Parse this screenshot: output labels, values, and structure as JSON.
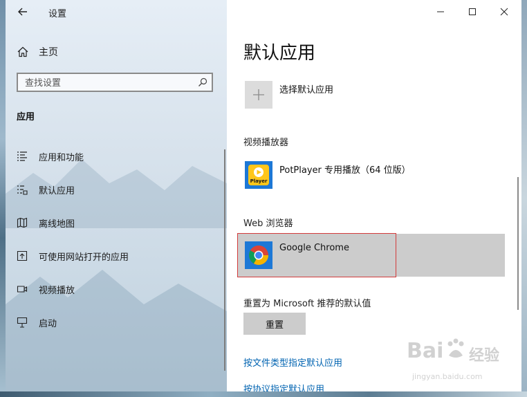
{
  "window": {
    "title": "设置"
  },
  "sidebar": {
    "home_label": "主页",
    "search_placeholder": "查找设置",
    "section_title": "应用",
    "items": [
      {
        "label": "应用和功能",
        "icon": "list-icon"
      },
      {
        "label": "默认应用",
        "icon": "default-apps-icon"
      },
      {
        "label": "离线地图",
        "icon": "map-icon"
      },
      {
        "label": "可使用网站打开的应用",
        "icon": "open-in-icon"
      },
      {
        "label": "视频播放",
        "icon": "video-icon"
      },
      {
        "label": "启动",
        "icon": "startup-icon"
      }
    ]
  },
  "main": {
    "title": "默认应用",
    "choose_default_label": "选择默认应用",
    "video_player": {
      "group": "视频播放器",
      "app": "PotPlayer 专用播放（64 位版）",
      "icon_text": "Player"
    },
    "web_browser": {
      "group": "Web 浏览器",
      "app": "Google Chrome"
    },
    "reset": {
      "label": "重置为 Microsoft 推荐的默认值",
      "button": "重置"
    },
    "links": [
      "按文件类型指定默认应用",
      "按协议指定默认应用"
    ]
  },
  "watermark": {
    "brand": "Bai",
    "brand_suffix": "经验",
    "url": "jingyan.baidu.com"
  },
  "colors": {
    "link": "#0063b1",
    "selected_row": "#cccccc",
    "highlight_border": "#d33b3b",
    "potplayer_bg": "#1d78d6",
    "potplayer_yellow": "#ffc61a"
  }
}
